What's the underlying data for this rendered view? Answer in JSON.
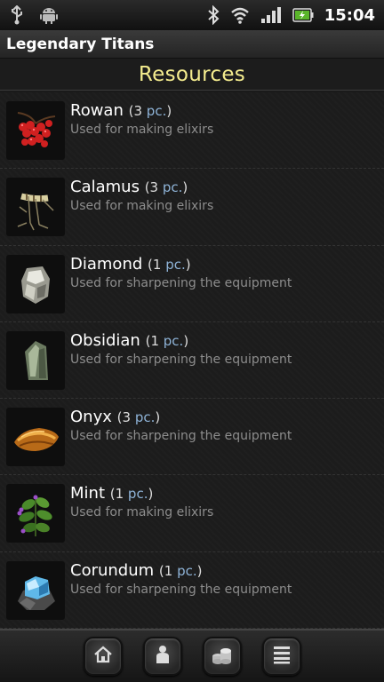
{
  "status_bar": {
    "time": "15:04",
    "icons": [
      "usb-icon",
      "android-icon",
      "bluetooth-icon",
      "wifi-icon",
      "signal-icon",
      "battery-charging-icon"
    ]
  },
  "app": {
    "title": "Legendary Titans"
  },
  "screen": {
    "title": "Resources"
  },
  "resources": [
    {
      "name": "Rowan",
      "count": "3",
      "unit": "pc.",
      "description": "Used for making elixirs",
      "icon": "rowan-berries-icon"
    },
    {
      "name": "Calamus",
      "count": "3",
      "unit": "pc.",
      "description": "Used for making elixirs",
      "icon": "calamus-root-icon"
    },
    {
      "name": "Diamond",
      "count": "1",
      "unit": "pc.",
      "description": "Used for sharpening the equipment",
      "icon": "diamond-icon"
    },
    {
      "name": "Obsidian",
      "count": "1",
      "unit": "pc.",
      "description": "Used for sharpening the equipment",
      "icon": "obsidian-icon"
    },
    {
      "name": "Onyx",
      "count": "3",
      "unit": "pc.",
      "description": "Used for sharpening the equipment",
      "icon": "onyx-icon"
    },
    {
      "name": "Mint",
      "count": "1",
      "unit": "pc.",
      "description": "Used for making elixirs",
      "icon": "mint-icon"
    },
    {
      "name": "Corundum",
      "count": "1",
      "unit": "pc.",
      "description": "Used for sharpening the equipment",
      "icon": "corundum-icon"
    }
  ],
  "bottom_nav": [
    "home-icon",
    "character-icon",
    "coins-icon",
    "menu-list-icon"
  ],
  "colors": {
    "title_accent": "#f4ec8e",
    "unit_accent": "#8fb4d8",
    "description": "#8d8d8d"
  }
}
